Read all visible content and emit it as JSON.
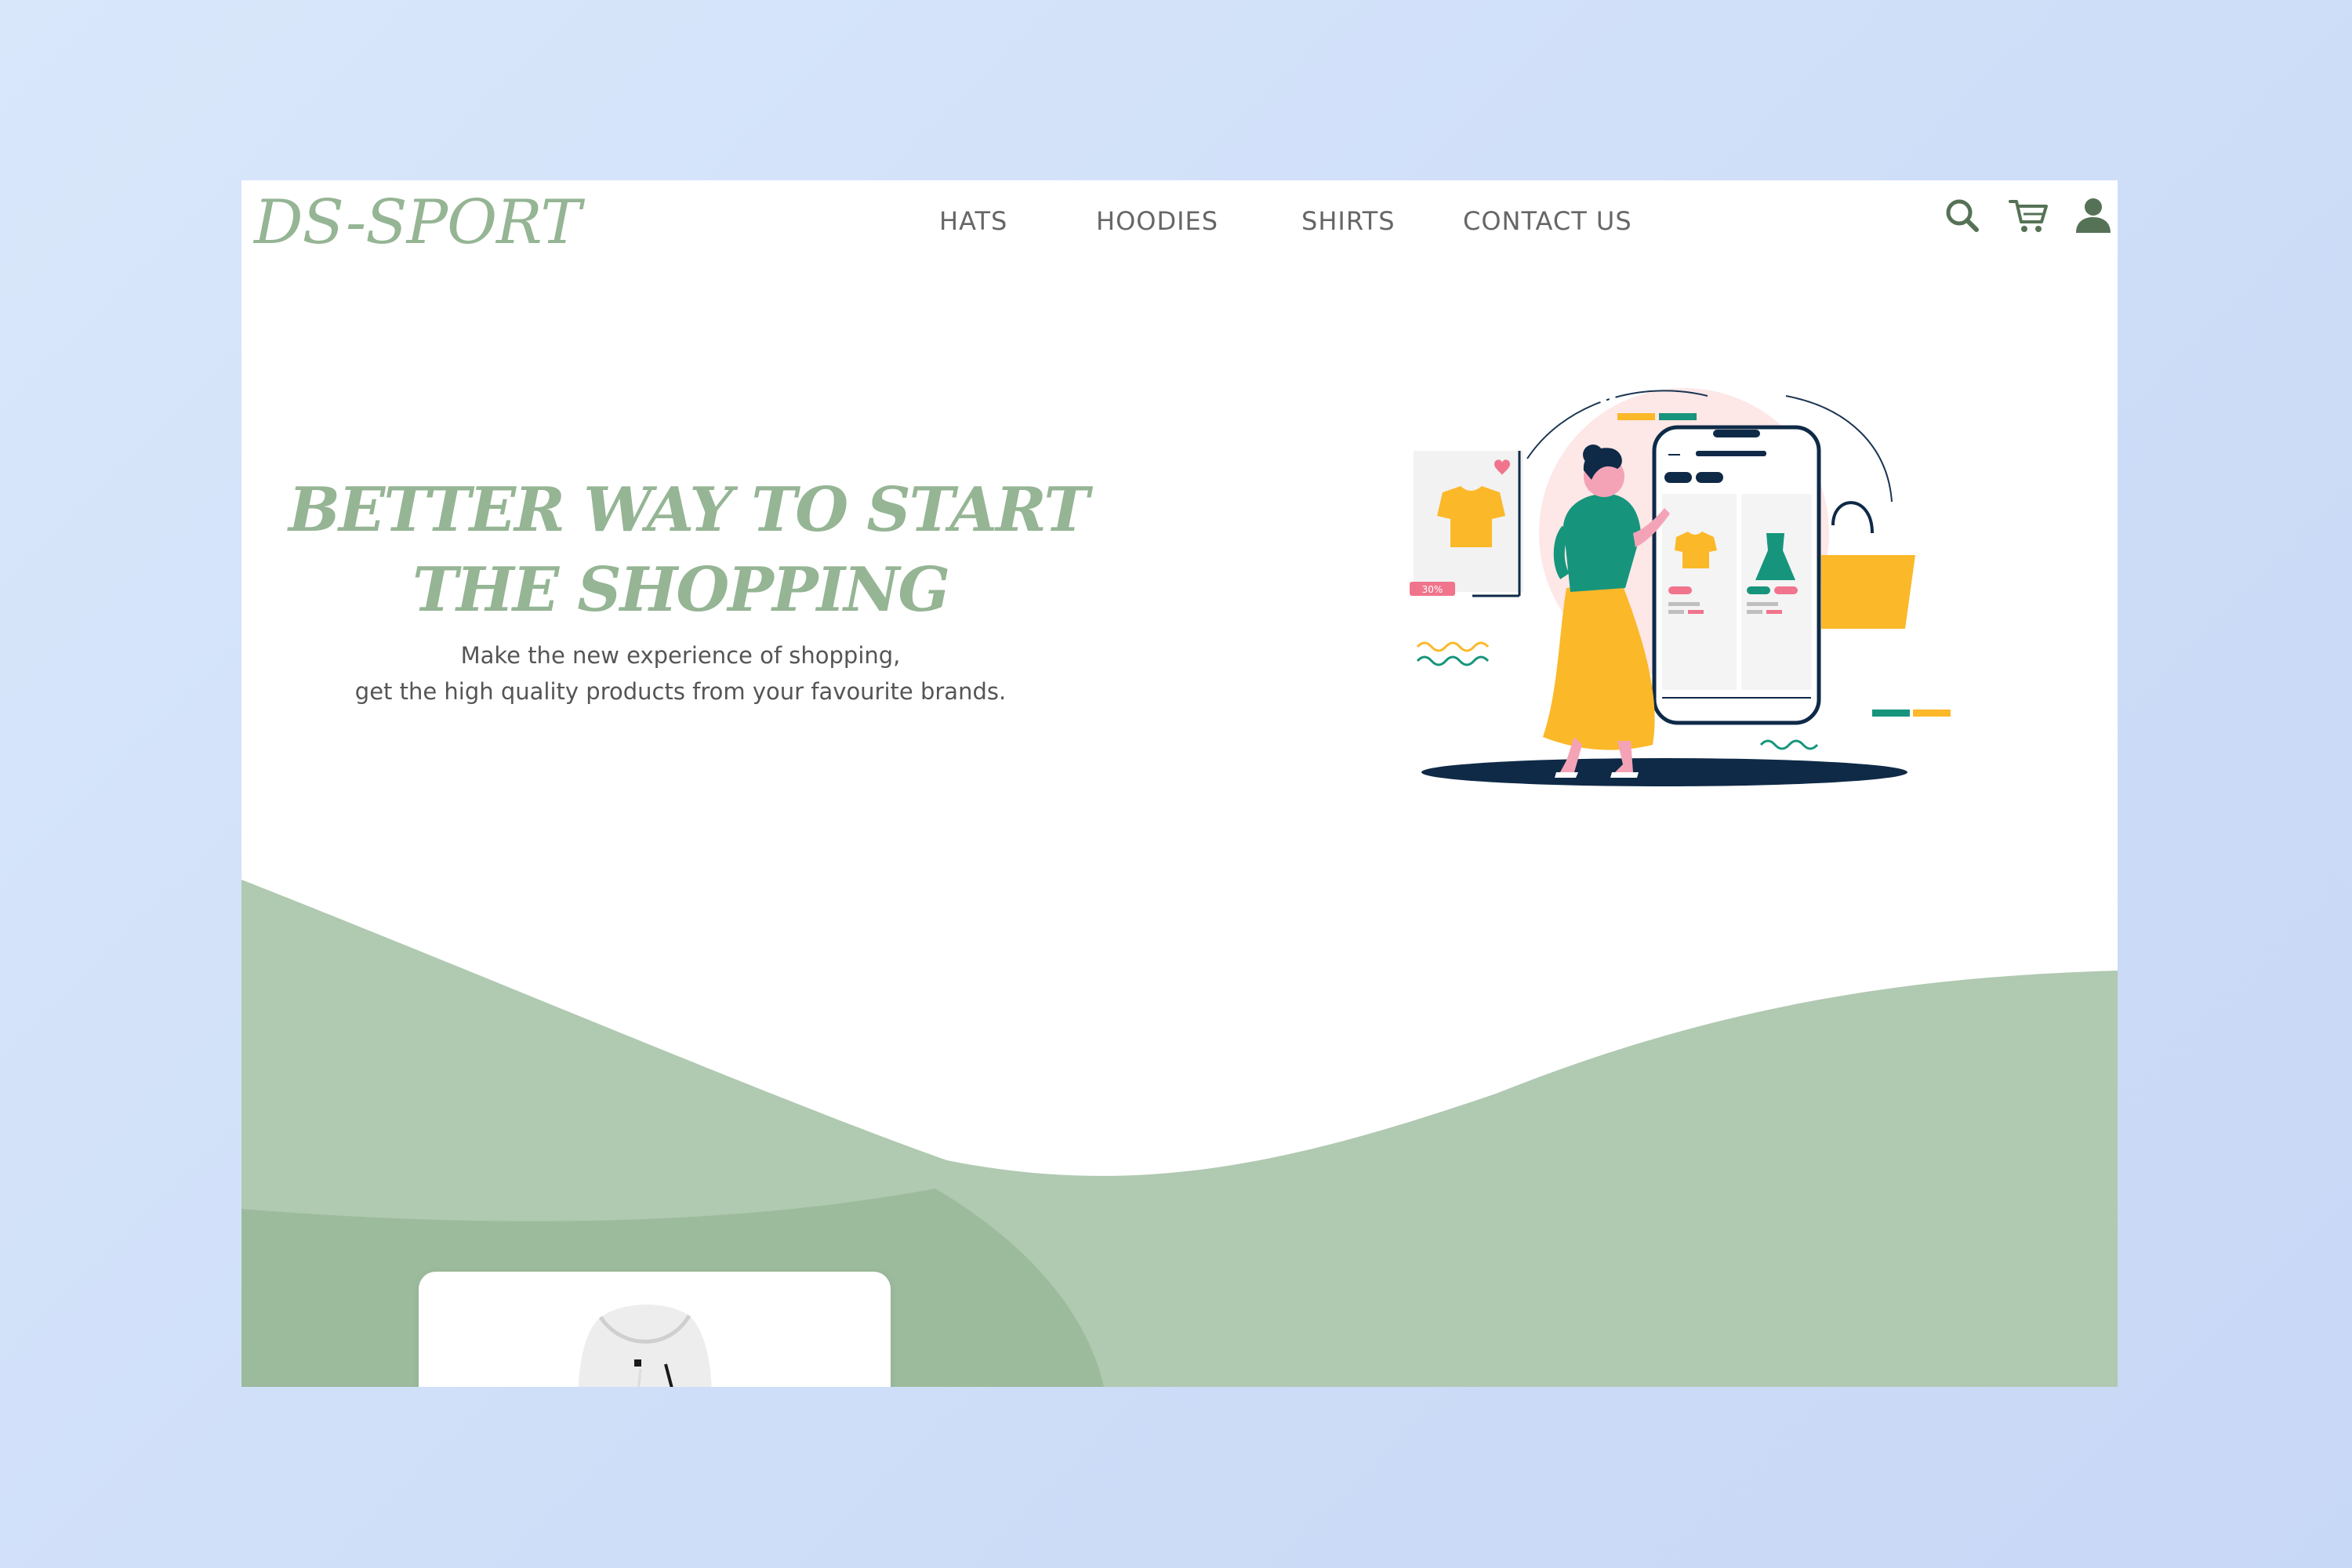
{
  "brand": {
    "logo_text": "DS-SPORT"
  },
  "nav": {
    "items": [
      {
        "label": "HATS"
      },
      {
        "label": "HOODIES"
      },
      {
        "label": "SHIRTS"
      },
      {
        "label": "CONTACT US"
      }
    ]
  },
  "header_icons": {
    "search": "search-icon",
    "cart": "cart-icon",
    "user": "user-icon"
  },
  "hero": {
    "title_line1": "BETTER WAY TO START",
    "title_line2": "THE SHOPPING",
    "subtitle_line1": "Make the new experience of shopping,",
    "subtitle_line2": "get the high quality products from your favourite brands.",
    "illustration_badge": "30%"
  },
  "colors": {
    "brand_green": "#95b594",
    "wave_light": "#b0c9b1",
    "wave_dark": "#9cbb9c",
    "accent_yellow": "#fbb829",
    "accent_teal": "#16957c",
    "navy": "#0f2a47",
    "pink": "#f0748c"
  },
  "product_card": {
    "icon": "hoodie-image"
  }
}
